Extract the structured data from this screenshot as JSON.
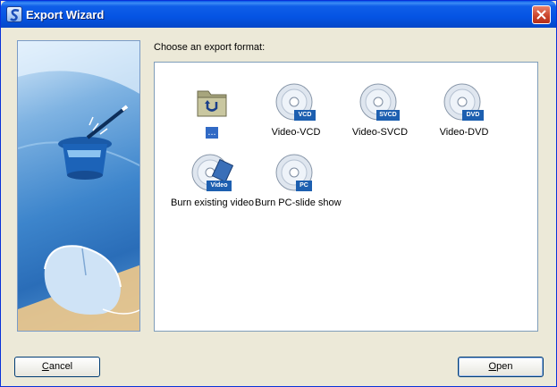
{
  "window": {
    "title": "Export Wizard"
  },
  "prompt": "Choose an export format:",
  "formats": [
    {
      "label": "...",
      "icon": "folder-icon",
      "badge": ""
    },
    {
      "label": "Video-VCD",
      "icon": "vcd-disc-icon",
      "badge": "VCD"
    },
    {
      "label": "Video-SVCD",
      "icon": "svcd-disc-icon",
      "badge": "SVCD"
    },
    {
      "label": "Video-DVD",
      "icon": "dvd-disc-icon",
      "badge": "DVD"
    },
    {
      "label": "Burn existing video",
      "icon": "video-disc-icon",
      "badge": "Video"
    },
    {
      "label": "Burn PC-slide show",
      "icon": "pc-disc-icon",
      "badge": "PC"
    }
  ],
  "buttons": {
    "cancel": {
      "mnemonic": "C",
      "rest": "ancel"
    },
    "open": {
      "mnemonic": "O",
      "rest": "pen"
    }
  },
  "colors": {
    "titlebar": "#0554e3",
    "selection": "#316ac5",
    "dialog": "#ece9d8",
    "badge": "#1d5fb0"
  }
}
